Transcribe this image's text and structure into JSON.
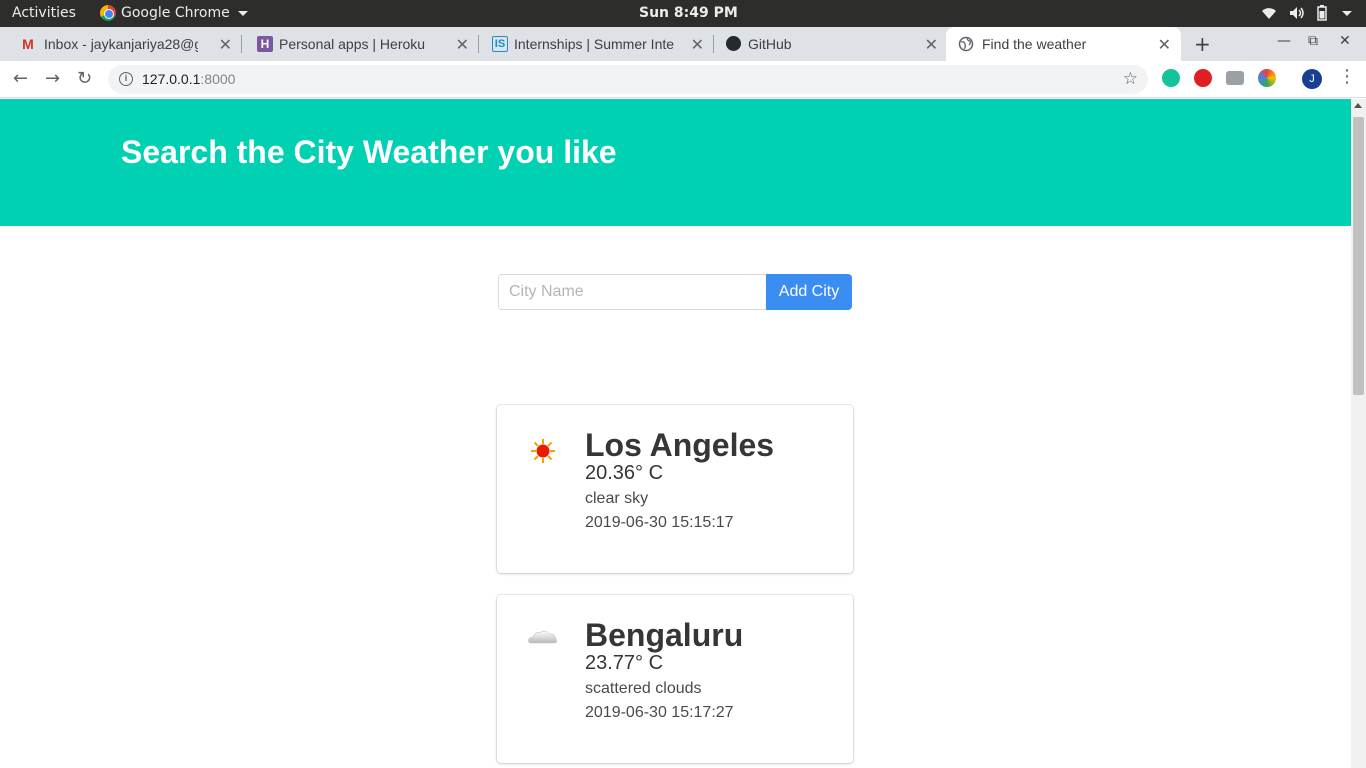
{
  "system": {
    "activities": "Activities",
    "app_name": "Google Chrome",
    "clock": "Sun  8:49 PM"
  },
  "tabs": [
    {
      "title": "Inbox - jaykanjariya28@g",
      "icon": "gmail-icon"
    },
    {
      "title": "Personal apps | Heroku",
      "icon": "heroku-icon"
    },
    {
      "title": "Internships | Summer Inte",
      "icon": "internshala-icon"
    },
    {
      "title": "GitHub",
      "icon": "github-icon"
    },
    {
      "title": "Find the weather",
      "icon": "globe-icon"
    }
  ],
  "address_bar": {
    "host": "127.0.0.1",
    "port": ":8000"
  },
  "profile_initial": "J",
  "page": {
    "heading": "Search the City Weather you like",
    "search_placeholder": "City Name",
    "add_button": "Add City"
  },
  "cards": [
    {
      "city": "Los Angeles",
      "temp": "20.36° C",
      "description": "clear sky",
      "time": "2019-06-30 15:15:17",
      "icon": "sun-icon"
    },
    {
      "city": "Bengaluru",
      "temp": "23.77° C",
      "description": "scattered clouds",
      "time": "2019-06-30 15:17:27",
      "icon": "cloud-icon"
    }
  ],
  "colors": {
    "hero": "#00d1b2",
    "button": "#3a8ef2"
  }
}
